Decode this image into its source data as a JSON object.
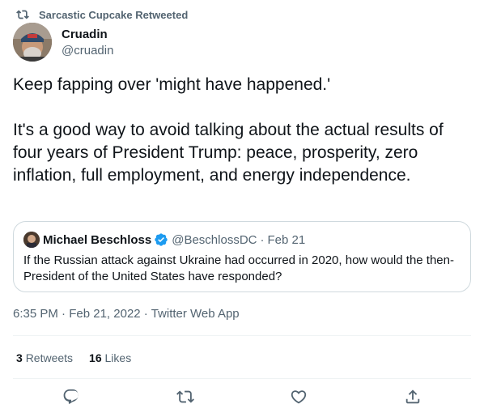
{
  "retweet_context": {
    "icon": "retweet-icon",
    "text": "Sarcastic Cupcake Retweeted"
  },
  "author": {
    "name": "Cruadin",
    "handle": "@cruadin",
    "avatar": "avatar"
  },
  "tweet": {
    "paragraphs": [
      "Keep fapping over 'might have happened.'",
      "It's a good way to avoid talking about the actual results of four years of President Trump: peace, prosperity, zero inflation, full employment, and energy independence."
    ]
  },
  "quoted_tweet": {
    "name": "Michael Beschloss",
    "verified": true,
    "handle": "@BeschlossDC",
    "separator": "·",
    "date": "Feb 21",
    "text": "If the Russian attack against Ukraine had occurred in 2020, how would the then-President of the United States have responded?"
  },
  "meta": {
    "time": "6:35 PM",
    "separator": "·",
    "date": "Feb 21, 2022",
    "source": "Twitter Web App"
  },
  "stats": {
    "retweets_count": "3",
    "retweets_label": "Retweets",
    "likes_count": "16",
    "likes_label": "Likes"
  },
  "actions": [
    "reply-icon",
    "retweet-icon",
    "like-icon",
    "share-icon"
  ],
  "colors": {
    "text_primary": "#0f1419",
    "text_secondary": "#536471",
    "border": "#cfd9de",
    "verified_blue": "#1d9bf0"
  }
}
